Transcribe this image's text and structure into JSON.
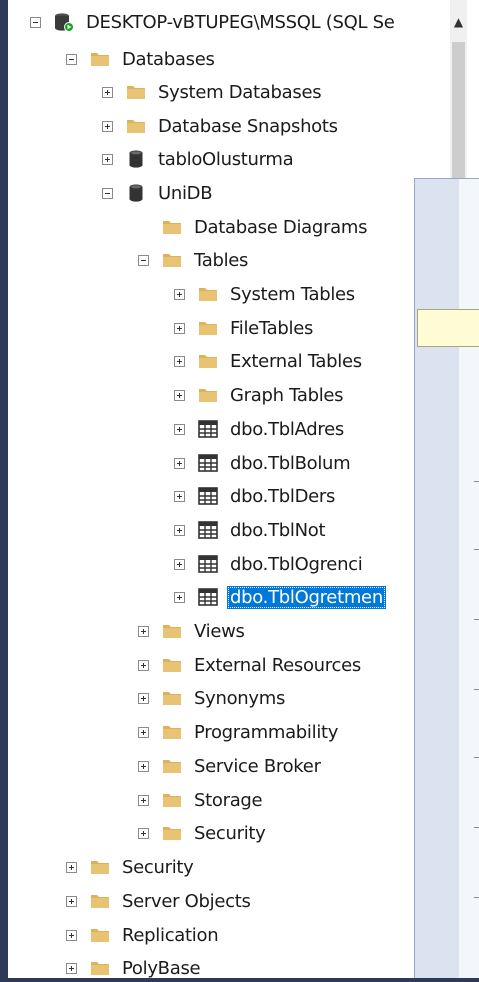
{
  "tree": {
    "server": {
      "label": "DESKTOP-vBTUPEG\\MSSQL (SQL Se",
      "icon": "server-connected-icon"
    },
    "databases": {
      "label": "Databases",
      "icon": "folder-icon"
    },
    "system_databases": {
      "label": "System Databases",
      "icon": "folder-icon"
    },
    "database_snapshots": {
      "label": "Database Snapshots",
      "icon": "folder-icon"
    },
    "tablo_olusturma": {
      "label": "tabloOlusturma",
      "icon": "database-icon"
    },
    "unidb": {
      "label": "UniDB",
      "icon": "database-icon"
    },
    "database_diagrams": {
      "label": "Database Diagrams",
      "icon": "folder-icon"
    },
    "tables": {
      "label": "Tables",
      "icon": "folder-icon"
    },
    "system_tables": {
      "label": "System Tables",
      "icon": "folder-icon"
    },
    "file_tables": {
      "label": "FileTables",
      "icon": "folder-icon"
    },
    "external_tables": {
      "label": "External Tables",
      "icon": "folder-icon"
    },
    "graph_tables": {
      "label": "Graph Tables",
      "icon": "folder-icon"
    },
    "tbl_adres": {
      "label": "dbo.TblAdres",
      "icon": "table-icon"
    },
    "tbl_bolum": {
      "label": "dbo.TblBolum",
      "icon": "table-icon"
    },
    "tbl_ders": {
      "label": "dbo.TblDers",
      "icon": "table-icon"
    },
    "tbl_not": {
      "label": "dbo.TblNot",
      "icon": "table-icon"
    },
    "tbl_ogrenci": {
      "label": "dbo.TblOgrenci",
      "icon": "table-icon"
    },
    "tbl_ogretmen": {
      "label": "dbo.TblOgretmen",
      "icon": "table-icon",
      "selected": true
    },
    "views": {
      "label": "Views",
      "icon": "folder-icon"
    },
    "external_resources": {
      "label": "External Resources",
      "icon": "folder-icon"
    },
    "synonyms": {
      "label": "Synonyms",
      "icon": "folder-icon"
    },
    "programmability": {
      "label": "Programmability",
      "icon": "folder-icon"
    },
    "service_broker": {
      "label": "Service Broker",
      "icon": "folder-icon"
    },
    "storage": {
      "label": "Storage",
      "icon": "folder-icon"
    },
    "db_security": {
      "label": "Security",
      "icon": "folder-icon"
    },
    "security": {
      "label": "Security",
      "icon": "folder-icon"
    },
    "server_objects": {
      "label": "Server Objects",
      "icon": "folder-icon"
    },
    "replication": {
      "label": "Replication",
      "icon": "folder-icon"
    },
    "polybase": {
      "label": "PolyBase",
      "icon": "folder-icon"
    }
  },
  "colors": {
    "selection": "#0078d7",
    "folder": "#dcb35c",
    "frame": "#2d3a5a"
  }
}
